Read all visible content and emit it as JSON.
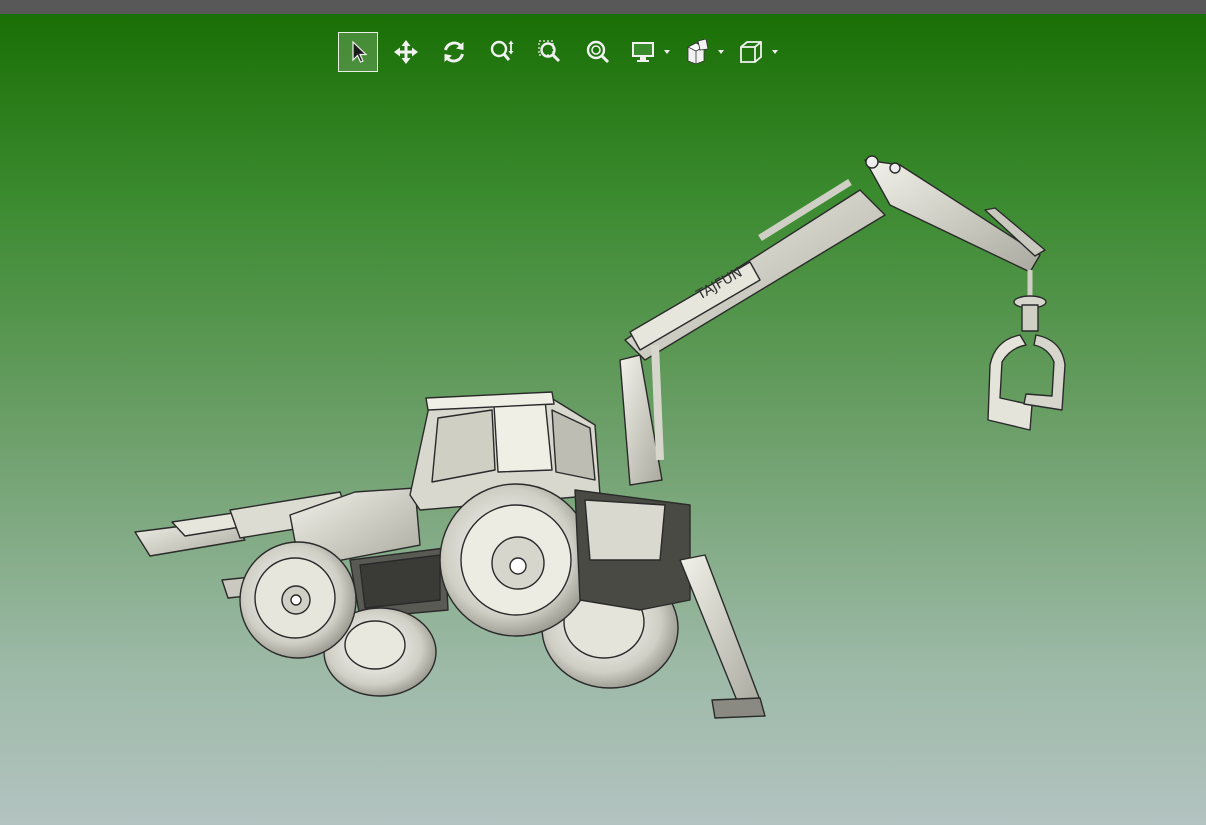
{
  "toolbar": {
    "tools": [
      {
        "name": "select-tool",
        "icon": "arrow-cursor-icon",
        "active": true
      },
      {
        "name": "pan-tool",
        "icon": "move-arrows-icon"
      },
      {
        "name": "rotate-tool",
        "icon": "rotate-icon"
      },
      {
        "name": "zoom-tool",
        "icon": "zoom-updown-icon"
      },
      {
        "name": "zoom-window-tool",
        "icon": "zoom-window-icon"
      },
      {
        "name": "zoom-fit-tool",
        "icon": "zoom-fit-icon"
      },
      {
        "name": "display-mode-menu",
        "icon": "monitor-icon"
      },
      {
        "name": "render-style-menu",
        "icon": "cubes-icon"
      },
      {
        "name": "view-orientation-menu",
        "icon": "cube-icon"
      }
    ]
  },
  "viewport": {
    "model_label": "TAJFUN",
    "colors": {
      "gradient_top": "#1a6f05",
      "gradient_bottom": "#b3c3c1",
      "part_fill": "#d6d6cc",
      "edge": "#2a2a2a"
    }
  }
}
